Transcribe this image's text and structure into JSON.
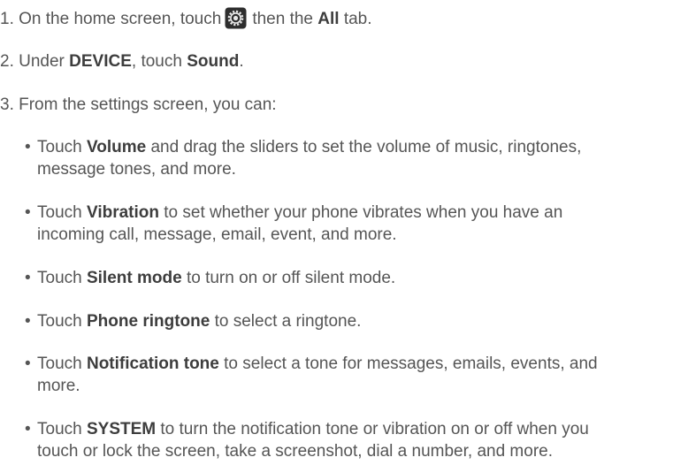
{
  "steps": [
    {
      "prefix": "1. On the home screen, touch",
      "icon": "settings-gear-icon",
      "middle": "then the",
      "bold": "All",
      "suffix": "tab."
    },
    {
      "prefix": "2. Under",
      "bold1": "DEVICE",
      "middle": ", touch",
      "bold2": "Sound",
      "suffix": "."
    },
    {
      "text": "3. From the settings screen, you can:"
    }
  ],
  "bullets": [
    {
      "lead": "Touch",
      "bold": "Volume",
      "line1": "and drag the sliders to set the volume of music, ringtones,",
      "line2": "message tones, and more."
    },
    {
      "lead": "Touch",
      "bold": "Vibration",
      "line1": "to set whether your phone vibrates when you have an",
      "line2": "incoming call, message, email, event, and more."
    },
    {
      "lead": "Touch",
      "bold": "Silent mode",
      "line1": "to turn on or off silent mode."
    },
    {
      "lead": "Touch",
      "bold": "Phone ringtone",
      "line1": "to select a ringtone."
    },
    {
      "lead": "Touch",
      "bold": "Notification tone",
      "line1": "to select a tone for messages, emails, events, and",
      "line2": "more."
    },
    {
      "lead": "Touch",
      "bold": "SYSTEM",
      "line1": "to turn the notification tone or vibration on or off when you",
      "line2": "touch or lock the screen, take a screenshot, dial a number, and more."
    }
  ],
  "colors": {
    "text": "#555555",
    "bold_text": "#3d3d3d",
    "icon_bg": "#2e2e2e",
    "icon_fg": "#e8e8e8"
  }
}
